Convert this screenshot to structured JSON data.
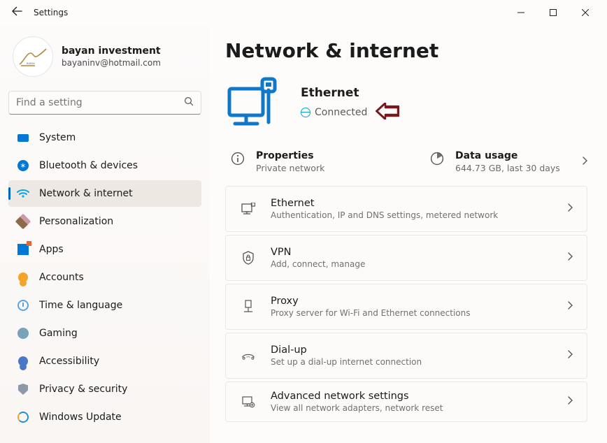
{
  "titlebar": {
    "title": "Settings"
  },
  "user": {
    "name": "bayan investment",
    "email": "bayaninv@hotmail.com"
  },
  "search": {
    "placeholder": "Find a setting"
  },
  "nav": [
    {
      "id": "system",
      "label": "System"
    },
    {
      "id": "bluetooth",
      "label": "Bluetooth & devices"
    },
    {
      "id": "network",
      "label": "Network & internet",
      "selected": true
    },
    {
      "id": "personalization",
      "label": "Personalization"
    },
    {
      "id": "apps",
      "label": "Apps"
    },
    {
      "id": "accounts",
      "label": "Accounts"
    },
    {
      "id": "time",
      "label": "Time & language"
    },
    {
      "id": "gaming",
      "label": "Gaming"
    },
    {
      "id": "accessibility",
      "label": "Accessibility"
    },
    {
      "id": "privacy",
      "label": "Privacy & security"
    },
    {
      "id": "update",
      "label": "Windows Update"
    }
  ],
  "page": {
    "title": "Network & internet",
    "hero": {
      "title": "Ethernet",
      "status": "Connected"
    },
    "properties": {
      "title": "Properties",
      "sub": "Private network"
    },
    "datausage": {
      "title": "Data usage",
      "sub": "644.73 GB, last 30 days"
    },
    "cards": [
      {
        "id": "ethernet",
        "title": "Ethernet",
        "sub": "Authentication, IP and DNS settings, metered network"
      },
      {
        "id": "vpn",
        "title": "VPN",
        "sub": "Add, connect, manage"
      },
      {
        "id": "proxy",
        "title": "Proxy",
        "sub": "Proxy server for Wi-Fi and Ethernet connections"
      },
      {
        "id": "dialup",
        "title": "Dial-up",
        "sub": "Set up a dial-up internet connection"
      },
      {
        "id": "advanced",
        "title": "Advanced network settings",
        "sub": "View all network adapters, network reset"
      }
    ]
  }
}
